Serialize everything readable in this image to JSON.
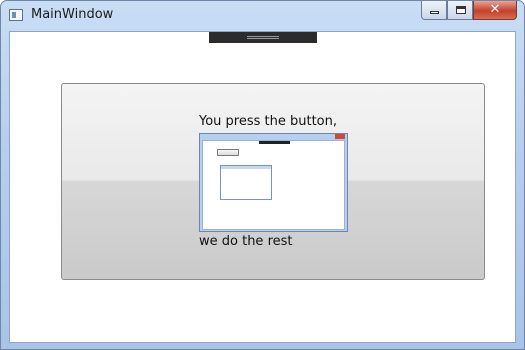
{
  "window": {
    "title": "MainWindow"
  },
  "panel": {
    "line1": "You press the button,",
    "line2": "we do the rest"
  },
  "controls": {
    "minimize_icon": "minimize-icon",
    "maximize_icon": "maximize-icon",
    "close_icon": "close-icon",
    "close_glyph": "✕"
  }
}
